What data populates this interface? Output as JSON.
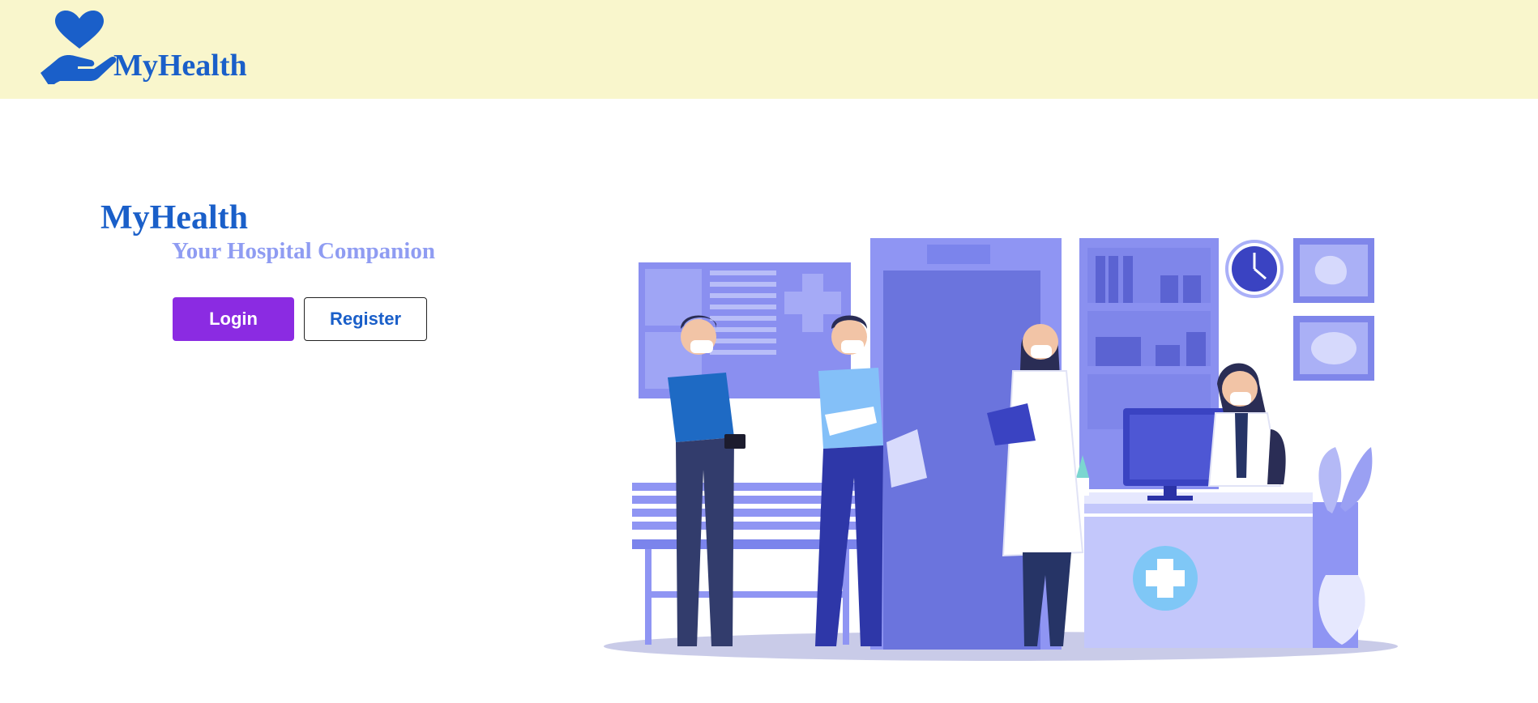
{
  "header": {
    "brand": "MyHealth",
    "logo_icon": "heart-in-hand-icon",
    "background": "#f9f6cc"
  },
  "hero": {
    "title": "MyHealth",
    "subtitle": "Your Hospital Companion"
  },
  "actions": {
    "login_label": "Login",
    "register_label": "Register"
  },
  "illustration": {
    "icon": "hospital-reception-illustration"
  },
  "colors": {
    "brand_blue": "#1a5fc9",
    "subtitle_lavender": "#8f9cf2",
    "login_purple": "#8b2be2"
  }
}
